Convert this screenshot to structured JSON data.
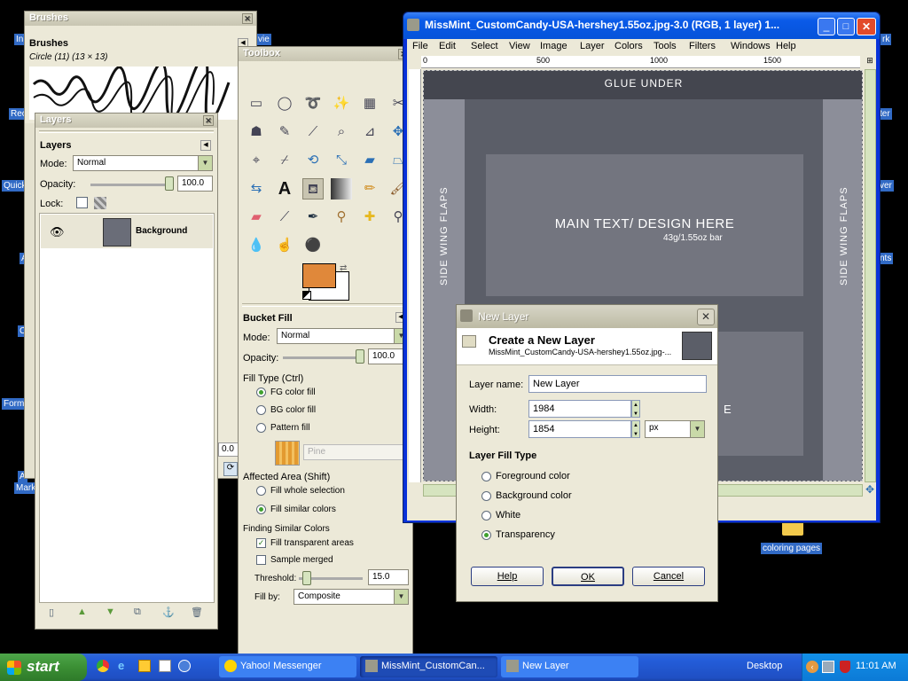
{
  "desktop": {
    "icons": [
      "In",
      "Rec",
      "Quick",
      "A",
      "C",
      "Forma",
      "A",
      "Mark",
      "vie",
      "ter",
      "ver",
      "nts",
      "rk",
      "coloring pages"
    ]
  },
  "brushes": {
    "title": "Brushes",
    "heading": "Brushes",
    "subtitle": "Circle (11) (13 × 13)",
    "spacing_value": "0.0"
  },
  "layers": {
    "title": "Layers",
    "heading": "Layers",
    "mode_label": "Mode:",
    "mode_value": "Normal",
    "opacity_label": "Opacity:",
    "opacity_value": "100.0",
    "opacity_level": 1.0,
    "lock_label": "Lock:",
    "layer_name": "Background"
  },
  "toolbox": {
    "title": "Toolbox",
    "fg_color": "#e0883a",
    "bg_color": "#ffffff",
    "tool_options": {
      "heading": "Bucket Fill",
      "mode_label": "Mode:",
      "mode_value": "Normal",
      "opacity_label": "Opacity:",
      "opacity_value": "100.0",
      "fill_type_heading": "Fill Type  (Ctrl)",
      "fill_types": [
        "FG color fill",
        "BG color fill",
        "Pattern fill"
      ],
      "pattern_name": "Pine",
      "affected_heading": "Affected Area  (Shift)",
      "affected": [
        "Fill whole selection",
        "Fill similar colors"
      ],
      "finding_heading": "Finding Similar Colors",
      "fill_transparent": "Fill transparent areas",
      "sample_merged": "Sample merged",
      "threshold_label": "Threshold:",
      "threshold_value": "15.0",
      "threshold_level": 0.06,
      "fill_by_label": "Fill by:",
      "fill_by_value": "Composite"
    }
  },
  "image_window": {
    "title": "MissMint_CustomCandy-USA-hershey1.55oz.jpg-3.0 (RGB, 1 layer) 1...",
    "menu": [
      "File",
      "Edit",
      "Select",
      "View",
      "Image",
      "Layer",
      "Colors",
      "Tools",
      "Filters",
      "Windows",
      "Help"
    ],
    "ruler": [
      "0",
      "500",
      "1000",
      "1500"
    ],
    "canvas": {
      "glue_under": "GLUE UNDER",
      "side_left": "SIDE WING FLAPS",
      "side_right": "SIDE WING FLAPS",
      "main_text": "MAIN TEXT/ DESIGN HERE",
      "sub_text": "43g/1.55oz bar",
      "partial_letter": "E"
    }
  },
  "dialog": {
    "title": "New Layer",
    "heading": "Create a New Layer",
    "filename": "MissMint_CustomCandy-USA-hershey1.55oz.jpg-...",
    "layer_name_label": "Layer name:",
    "layer_name_value": "New Layer",
    "width_label": "Width:",
    "width_value": "1984",
    "height_label": "Height:",
    "height_value": "1854",
    "unit": "px",
    "fill_type_heading": "Layer Fill Type",
    "fill_options": [
      "Foreground color",
      "Background color",
      "White",
      "Transparency"
    ],
    "help_btn": "Help",
    "ok_btn": "OK",
    "cancel_btn": "Cancel"
  },
  "taskbar": {
    "start": "start",
    "tasks": [
      "Yahoo! Messenger",
      "MissMint_CustomCan...",
      "New Layer"
    ],
    "desktop_label": "Desktop",
    "clock": "11:01 AM"
  }
}
